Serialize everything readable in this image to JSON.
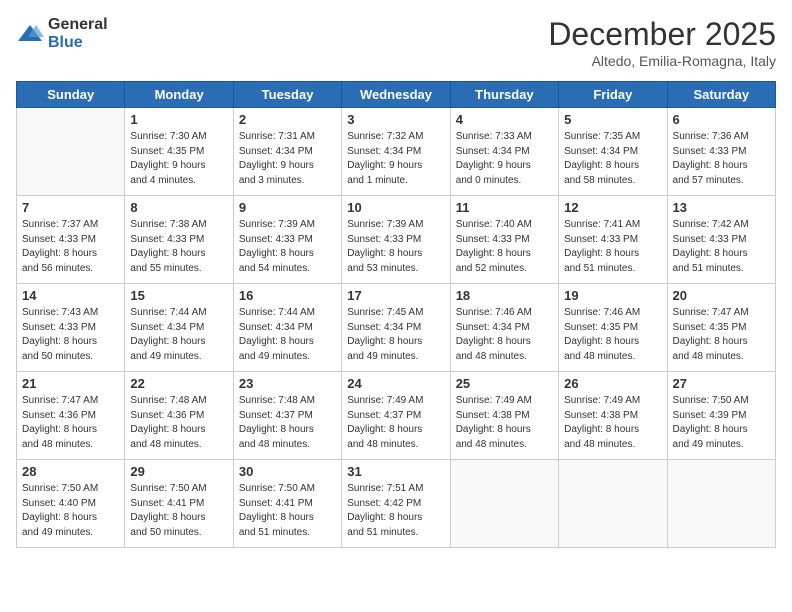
{
  "logo": {
    "general": "General",
    "blue": "Blue"
  },
  "header": {
    "month": "December 2025",
    "location": "Altedo, Emilia-Romagna, Italy"
  },
  "weekdays": [
    "Sunday",
    "Monday",
    "Tuesday",
    "Wednesday",
    "Thursday",
    "Friday",
    "Saturday"
  ],
  "weeks": [
    [
      {
        "day": "",
        "info": ""
      },
      {
        "day": "1",
        "info": "Sunrise: 7:30 AM\nSunset: 4:35 PM\nDaylight: 9 hours\nand 4 minutes."
      },
      {
        "day": "2",
        "info": "Sunrise: 7:31 AM\nSunset: 4:34 PM\nDaylight: 9 hours\nand 3 minutes."
      },
      {
        "day": "3",
        "info": "Sunrise: 7:32 AM\nSunset: 4:34 PM\nDaylight: 9 hours\nand 1 minute."
      },
      {
        "day": "4",
        "info": "Sunrise: 7:33 AM\nSunset: 4:34 PM\nDaylight: 9 hours\nand 0 minutes."
      },
      {
        "day": "5",
        "info": "Sunrise: 7:35 AM\nSunset: 4:34 PM\nDaylight: 8 hours\nand 58 minutes."
      },
      {
        "day": "6",
        "info": "Sunrise: 7:36 AM\nSunset: 4:33 PM\nDaylight: 8 hours\nand 57 minutes."
      }
    ],
    [
      {
        "day": "7",
        "info": "Sunrise: 7:37 AM\nSunset: 4:33 PM\nDaylight: 8 hours\nand 56 minutes."
      },
      {
        "day": "8",
        "info": "Sunrise: 7:38 AM\nSunset: 4:33 PM\nDaylight: 8 hours\nand 55 minutes."
      },
      {
        "day": "9",
        "info": "Sunrise: 7:39 AM\nSunset: 4:33 PM\nDaylight: 8 hours\nand 54 minutes."
      },
      {
        "day": "10",
        "info": "Sunrise: 7:39 AM\nSunset: 4:33 PM\nDaylight: 8 hours\nand 53 minutes."
      },
      {
        "day": "11",
        "info": "Sunrise: 7:40 AM\nSunset: 4:33 PM\nDaylight: 8 hours\nand 52 minutes."
      },
      {
        "day": "12",
        "info": "Sunrise: 7:41 AM\nSunset: 4:33 PM\nDaylight: 8 hours\nand 51 minutes."
      },
      {
        "day": "13",
        "info": "Sunrise: 7:42 AM\nSunset: 4:33 PM\nDaylight: 8 hours\nand 51 minutes."
      }
    ],
    [
      {
        "day": "14",
        "info": "Sunrise: 7:43 AM\nSunset: 4:33 PM\nDaylight: 8 hours\nand 50 minutes."
      },
      {
        "day": "15",
        "info": "Sunrise: 7:44 AM\nSunset: 4:34 PM\nDaylight: 8 hours\nand 49 minutes."
      },
      {
        "day": "16",
        "info": "Sunrise: 7:44 AM\nSunset: 4:34 PM\nDaylight: 8 hours\nand 49 minutes."
      },
      {
        "day": "17",
        "info": "Sunrise: 7:45 AM\nSunset: 4:34 PM\nDaylight: 8 hours\nand 49 minutes."
      },
      {
        "day": "18",
        "info": "Sunrise: 7:46 AM\nSunset: 4:34 PM\nDaylight: 8 hours\nand 48 minutes."
      },
      {
        "day": "19",
        "info": "Sunrise: 7:46 AM\nSunset: 4:35 PM\nDaylight: 8 hours\nand 48 minutes."
      },
      {
        "day": "20",
        "info": "Sunrise: 7:47 AM\nSunset: 4:35 PM\nDaylight: 8 hours\nand 48 minutes."
      }
    ],
    [
      {
        "day": "21",
        "info": "Sunrise: 7:47 AM\nSunset: 4:36 PM\nDaylight: 8 hours\nand 48 minutes."
      },
      {
        "day": "22",
        "info": "Sunrise: 7:48 AM\nSunset: 4:36 PM\nDaylight: 8 hours\nand 48 minutes."
      },
      {
        "day": "23",
        "info": "Sunrise: 7:48 AM\nSunset: 4:37 PM\nDaylight: 8 hours\nand 48 minutes."
      },
      {
        "day": "24",
        "info": "Sunrise: 7:49 AM\nSunset: 4:37 PM\nDaylight: 8 hours\nand 48 minutes."
      },
      {
        "day": "25",
        "info": "Sunrise: 7:49 AM\nSunset: 4:38 PM\nDaylight: 8 hours\nand 48 minutes."
      },
      {
        "day": "26",
        "info": "Sunrise: 7:49 AM\nSunset: 4:38 PM\nDaylight: 8 hours\nand 48 minutes."
      },
      {
        "day": "27",
        "info": "Sunrise: 7:50 AM\nSunset: 4:39 PM\nDaylight: 8 hours\nand 49 minutes."
      }
    ],
    [
      {
        "day": "28",
        "info": "Sunrise: 7:50 AM\nSunset: 4:40 PM\nDaylight: 8 hours\nand 49 minutes."
      },
      {
        "day": "29",
        "info": "Sunrise: 7:50 AM\nSunset: 4:41 PM\nDaylight: 8 hours\nand 50 minutes."
      },
      {
        "day": "30",
        "info": "Sunrise: 7:50 AM\nSunset: 4:41 PM\nDaylight: 8 hours\nand 51 minutes."
      },
      {
        "day": "31",
        "info": "Sunrise: 7:51 AM\nSunset: 4:42 PM\nDaylight: 8 hours\nand 51 minutes."
      },
      {
        "day": "",
        "info": ""
      },
      {
        "day": "",
        "info": ""
      },
      {
        "day": "",
        "info": ""
      }
    ]
  ]
}
